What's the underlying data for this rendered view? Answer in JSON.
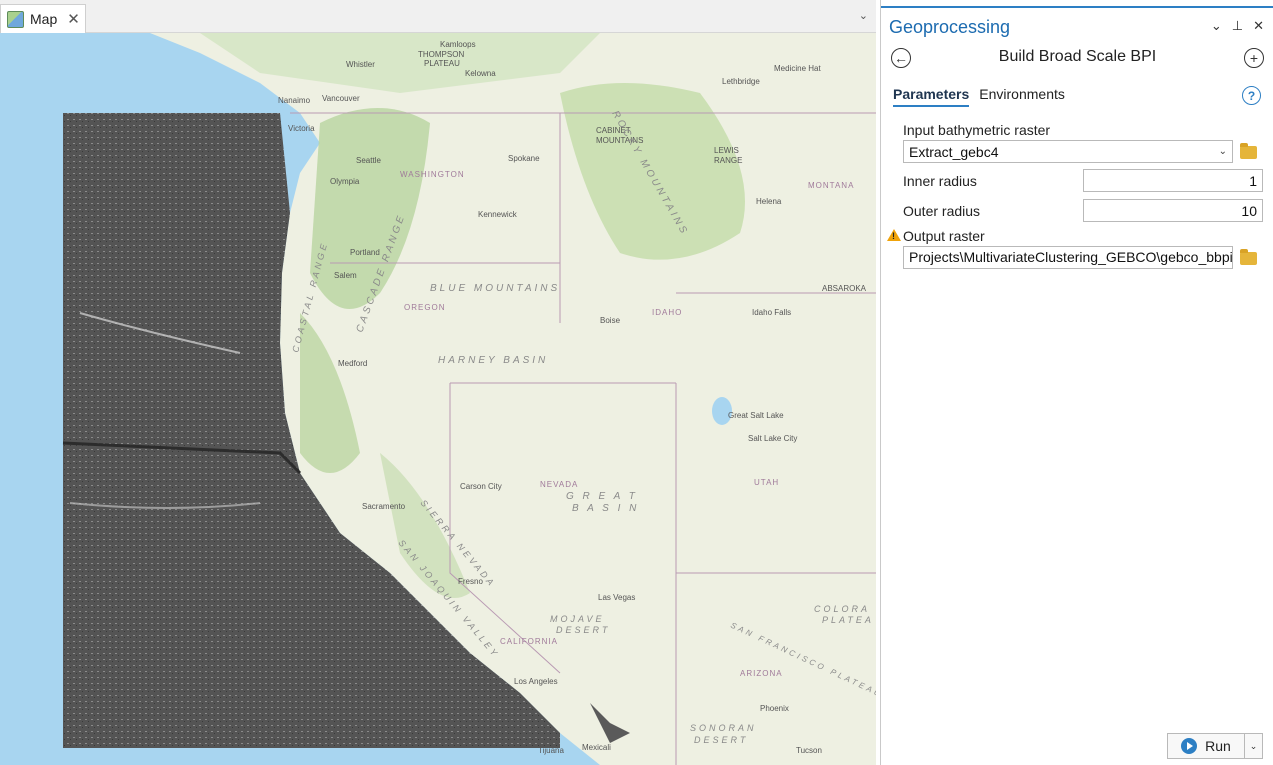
{
  "map": {
    "tab_label": "Map",
    "close_glyph": "✕",
    "menu_glyph": "⌄",
    "labels": {
      "kamloops": "Kamloops",
      "thompson": "THOMPSON",
      "plateau": "PLATEAU",
      "whistler": "Whistler",
      "kelowna": "Kelowna",
      "medicine_hat": "Medicine Hat",
      "lethbridge": "Lethbridge",
      "nanaimo": "Nanaimo",
      "vancouver": "Vancouver",
      "victoria": "Victoria",
      "seattle": "Seattle",
      "olympia": "Olympia",
      "washington": "WASHINGTON",
      "spokane": "Spokane",
      "cabinet": "CABINET",
      "mountains": "MOUNTAINS",
      "lewis": "LEWIS",
      "range": "RANGE",
      "montana": "MONTANA",
      "helena": "Helena",
      "kennewick": "Kennewick",
      "portland": "Portland",
      "salem": "Salem",
      "blue_mountains": "BLUE MOUNTAINS",
      "oregon": "OREGON",
      "idaho": "IDAHO",
      "boise": "Boise",
      "idaho_falls": "Idaho Falls",
      "absaroka": "ABSAROKA",
      "medford": "Medford",
      "harney_basin": "HARNEY BASIN",
      "cascade_range": "CASCADE RANGE",
      "coastal_range": "COASTAL RANGE",
      "rocky_mountains": "ROCKY MOUNTAINS",
      "great_salt_lake": "Great Salt Lake",
      "salt_lake_city": "Salt Lake City",
      "carson_city": "Carson City",
      "nevada": "NEVADA",
      "great": "G R E A T",
      "basin": "B A S I N",
      "utah": "UTAH",
      "sacramento": "Sacramento",
      "sierra_nevada": "SIERRA NEVADA",
      "san_joaquin_valley": "SAN JOAQUIN VALLEY",
      "fresno": "Fresno",
      "las_vegas": "Las Vegas",
      "mojave": "MOJAVE",
      "desert": "DESERT",
      "california": "CALIFORNIA",
      "colorado": "COLORA",
      "plateau2": "PLATEA",
      "san_francisco_plateau": "SAN FRANCISCO PLATEAU",
      "los_angeles": "Los Angeles",
      "arizona": "ARIZONA",
      "phoenix": "Phoenix",
      "sonoran": "SONORAN",
      "desert2": "DESERT",
      "tijuana": "Tijuana",
      "mexicali": "Mexicali",
      "tucson": "Tucson"
    }
  },
  "gp": {
    "title": "Geoprocessing",
    "ctrl_menu": "⌄",
    "ctrl_pin": "⊥",
    "ctrl_close": "✕",
    "back_glyph": "←",
    "add_glyph": "+",
    "tool_name": "Build Broad Scale BPI",
    "tabs": [
      {
        "label": "Parameters",
        "active": true
      },
      {
        "label": "Environments",
        "active": false
      }
    ],
    "help_glyph": "?",
    "params": {
      "input_raster_label": "Input bathymetric raster",
      "input_raster_value": "Extract_gebc4",
      "inner_radius_label": "Inner radius",
      "inner_radius_value": "1",
      "outer_radius_label": "Outer radius",
      "outer_radius_value": "10",
      "output_raster_label": "Output raster",
      "output_raster_value": "Projects\\MultivariateClustering_GEBCO\\gebco_bbpi.tif"
    },
    "warning_glyph": "!",
    "run_label": "Run",
    "run_drop_glyph": "⌄"
  },
  "colors": {
    "accent": "#2d7fc4",
    "ocean": "#a8d5f0",
    "land": "#eef0e2",
    "forest": "#b8d4a0",
    "raster": "#5a5a5a",
    "warning": "#f0a30a"
  }
}
